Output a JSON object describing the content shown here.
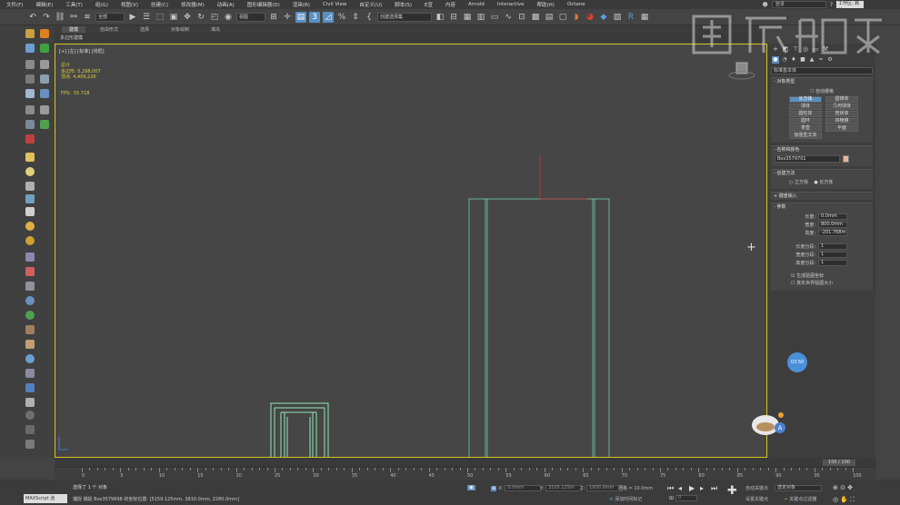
{
  "menu": [
    "文件(F)",
    "编辑(E)",
    "工具(T)",
    "组(G)",
    "视图(V)",
    "创建(C)",
    "修改器(M)",
    "动画(A)",
    "图形编辑器(D)",
    "渲染(R)",
    "Civil View",
    "自定义(U)",
    "脚本(S)",
    "E宣",
    "内容",
    "Arnold",
    "Interactive",
    "帮助(H)",
    "Octane"
  ],
  "menu_right": {
    "login": "登录",
    "workspace": "工作区: 默认"
  },
  "toolbar": {
    "filter": "全部",
    "view": "视图",
    "selection_set": "创建选择集"
  },
  "ribbon": {
    "tabs": [
      "建模",
      "自由形式",
      "选择",
      "对象绘制",
      "填充"
    ],
    "sub": "多边形建模"
  },
  "viewport": {
    "label": "[+] [左] [标准] [线框]",
    "stats": {
      "title": "总计",
      "poly_label": "多边形:",
      "poly": "5,298,007",
      "vert_label": "顶点:",
      "vert": "4,409,226"
    },
    "fps_label": "FPS:",
    "fps": "55.718"
  },
  "command_panel": {
    "category": "标准基本体",
    "object_type": {
      "title": "对象类型",
      "autogrid": "自动栅格",
      "buttons": [
        "长方体",
        "圆锥体",
        "球体",
        "几何球体",
        "圆柱体",
        "管状体",
        "圆环",
        "四棱锥",
        "茶壶",
        "平面",
        "加强型文本"
      ]
    },
    "name_color": {
      "title": "名称和颜色",
      "name": "Box3579701"
    },
    "creation_method": {
      "title": "创建方法",
      "options": [
        "立方体",
        "长方体"
      ]
    },
    "keyboard_entry": {
      "title": "键盘输入"
    },
    "params": {
      "title": "参数",
      "fields": [
        {
          "label": "长度:",
          "value": "0.0mm"
        },
        {
          "label": "宽度:",
          "value": "800.0mm"
        },
        {
          "label": "高度:",
          "value": "-201.768m"
        },
        {
          "label": "长度分段:",
          "value": "1"
        },
        {
          "label": "宽度分段:",
          "value": "1"
        },
        {
          "label": "高度分段:",
          "value": "1"
        }
      ],
      "checks": [
        "生成贴图坐标",
        "真实世界贴图大小"
      ]
    }
  },
  "timeline": {
    "frame": "100 / 100",
    "ticks": [
      "0",
      "5",
      "10",
      "15",
      "20",
      "25",
      "30",
      "35",
      "40",
      "45",
      "50",
      "55",
      "60",
      "65",
      "70",
      "75",
      "80",
      "85",
      "90",
      "95",
      "100"
    ]
  },
  "status": {
    "maxscript": "MAXScript 迷",
    "selected": "选择了 1 个 对象",
    "snap": "捕捉 捕捉 Box3579698 的坐标位置: [5159.125mm, 3810.0mm, 2280.0mm]",
    "x_label": "X:",
    "x": "0.0mm",
    "y_label": "Y:",
    "y": "3105.125m",
    "z_label": "Z:",
    "z": "1900.0mm",
    "grid": "栅格 = 10.0mm",
    "add_time_tag": "添加时间标记",
    "auto_key": "自动关键点",
    "selected_obj": "选定对象",
    "set_key": "设置关键点",
    "key_filter": "关键点过滤器",
    "frame": "0"
  },
  "timer": "03:50"
}
